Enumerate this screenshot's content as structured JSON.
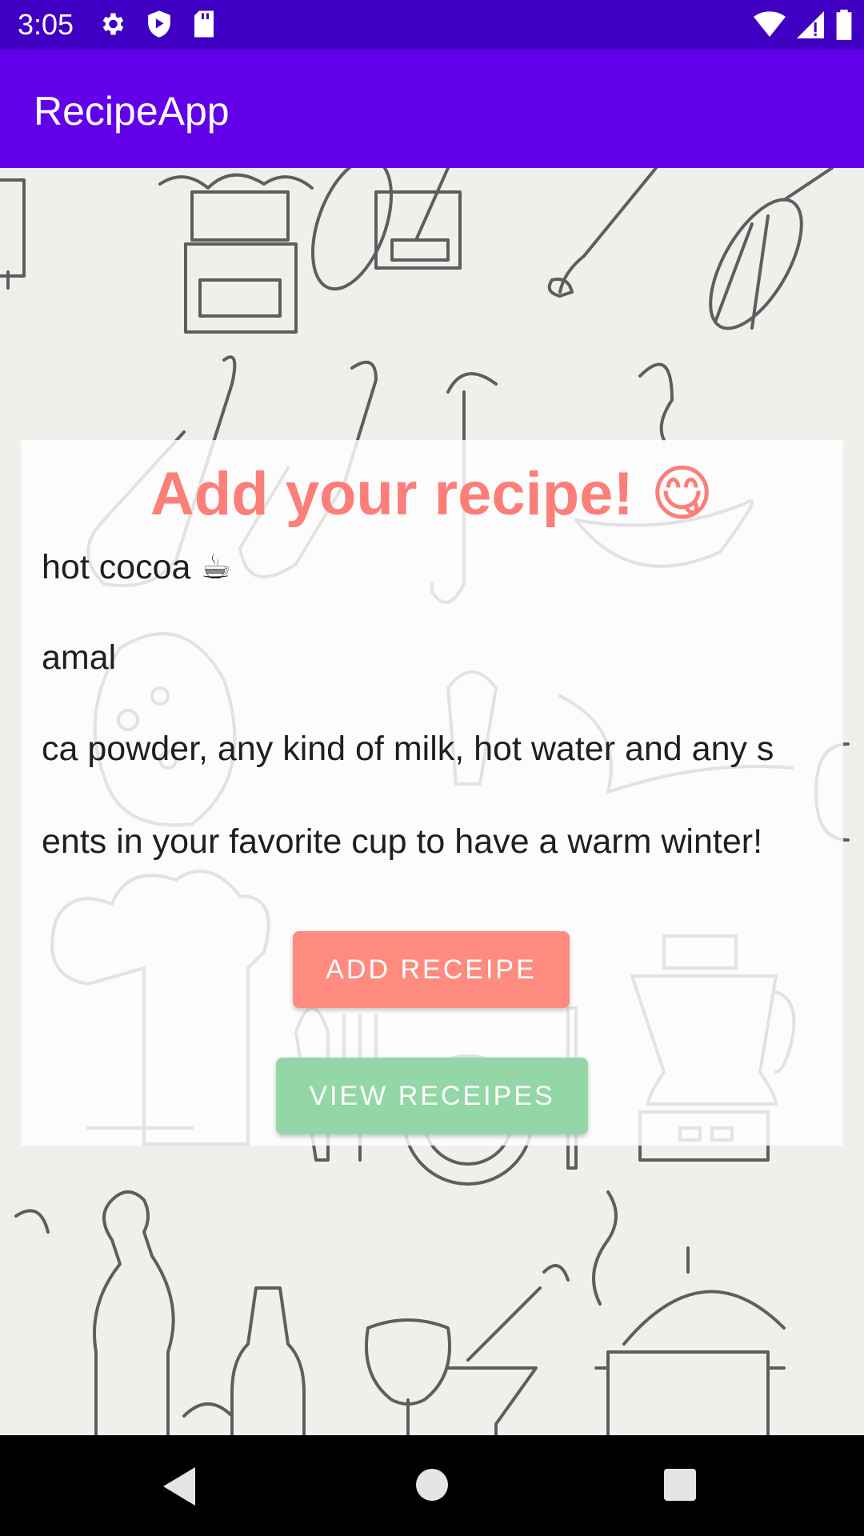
{
  "status_bar": {
    "time": "3:05",
    "left_icons": [
      "settings-gear-icon",
      "play-shield-icon",
      "sd-card-icon"
    ],
    "right_icons": [
      "wifi-icon",
      "cell-signal-icon",
      "battery-icon"
    ]
  },
  "app_bar": {
    "title": "RecipeApp",
    "color": "#6200ea"
  },
  "card": {
    "title": "Add your recipe! 😋",
    "fields": {
      "name": "hot cocoa ☕",
      "author": "amal",
      "ingredients": "ca powder, any kind of milk, hot water and any s",
      "instructions": "ents in your favorite cup to have a warm winter!"
    },
    "add_button": "ADD RECEIPE",
    "view_button": "VIEW RECEIPES"
  },
  "nav_bar": {
    "icons": [
      "back-icon",
      "home-icon",
      "recents-icon"
    ]
  },
  "colors": {
    "title": "#fb7f78",
    "add_button": "#fe8b80",
    "view_button": "#93d7a6",
    "status_bar": "#3f00c4"
  }
}
